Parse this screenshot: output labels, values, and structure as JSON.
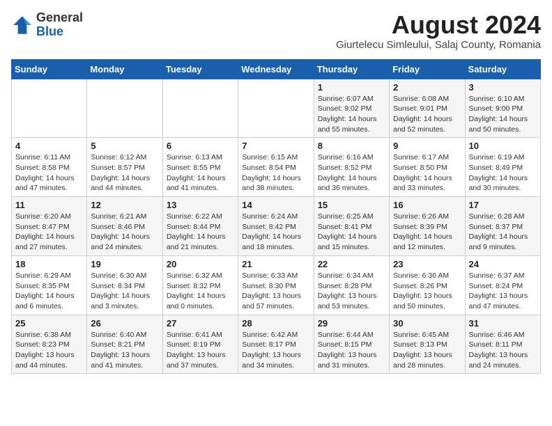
{
  "logo": {
    "general": "General",
    "blue": "Blue"
  },
  "title": "August 2024",
  "subtitle": "Giurtelecu Simleului, Salaj County, Romania",
  "weekdays": [
    "Sunday",
    "Monday",
    "Tuesday",
    "Wednesday",
    "Thursday",
    "Friday",
    "Saturday"
  ],
  "weeks": [
    [
      {
        "day": "",
        "info": ""
      },
      {
        "day": "",
        "info": ""
      },
      {
        "day": "",
        "info": ""
      },
      {
        "day": "",
        "info": ""
      },
      {
        "day": "1",
        "info": "Sunrise: 6:07 AM\nSunset: 9:02 PM\nDaylight: 14 hours\nand 55 minutes."
      },
      {
        "day": "2",
        "info": "Sunrise: 6:08 AM\nSunset: 9:01 PM\nDaylight: 14 hours\nand 52 minutes."
      },
      {
        "day": "3",
        "info": "Sunrise: 6:10 AM\nSunset: 9:00 PM\nDaylight: 14 hours\nand 50 minutes."
      }
    ],
    [
      {
        "day": "4",
        "info": "Sunrise: 6:11 AM\nSunset: 8:58 PM\nDaylight: 14 hours\nand 47 minutes."
      },
      {
        "day": "5",
        "info": "Sunrise: 6:12 AM\nSunset: 8:57 PM\nDaylight: 14 hours\nand 44 minutes."
      },
      {
        "day": "6",
        "info": "Sunrise: 6:13 AM\nSunset: 8:55 PM\nDaylight: 14 hours\nand 41 minutes."
      },
      {
        "day": "7",
        "info": "Sunrise: 6:15 AM\nSunset: 8:54 PM\nDaylight: 14 hours\nand 38 minutes."
      },
      {
        "day": "8",
        "info": "Sunrise: 6:16 AM\nSunset: 8:52 PM\nDaylight: 14 hours\nand 36 minutes."
      },
      {
        "day": "9",
        "info": "Sunrise: 6:17 AM\nSunset: 8:50 PM\nDaylight: 14 hours\nand 33 minutes."
      },
      {
        "day": "10",
        "info": "Sunrise: 6:19 AM\nSunset: 8:49 PM\nDaylight: 14 hours\nand 30 minutes."
      }
    ],
    [
      {
        "day": "11",
        "info": "Sunrise: 6:20 AM\nSunset: 8:47 PM\nDaylight: 14 hours\nand 27 minutes."
      },
      {
        "day": "12",
        "info": "Sunrise: 6:21 AM\nSunset: 8:46 PM\nDaylight: 14 hours\nand 24 minutes."
      },
      {
        "day": "13",
        "info": "Sunrise: 6:22 AM\nSunset: 8:44 PM\nDaylight: 14 hours\nand 21 minutes."
      },
      {
        "day": "14",
        "info": "Sunrise: 6:24 AM\nSunset: 8:42 PM\nDaylight: 14 hours\nand 18 minutes."
      },
      {
        "day": "15",
        "info": "Sunrise: 6:25 AM\nSunset: 8:41 PM\nDaylight: 14 hours\nand 15 minutes."
      },
      {
        "day": "16",
        "info": "Sunrise: 6:26 AM\nSunset: 8:39 PM\nDaylight: 14 hours\nand 12 minutes."
      },
      {
        "day": "17",
        "info": "Sunrise: 6:28 AM\nSunset: 8:37 PM\nDaylight: 14 hours\nand 9 minutes."
      }
    ],
    [
      {
        "day": "18",
        "info": "Sunrise: 6:29 AM\nSunset: 8:35 PM\nDaylight: 14 hours\nand 6 minutes."
      },
      {
        "day": "19",
        "info": "Sunrise: 6:30 AM\nSunset: 8:34 PM\nDaylight: 14 hours\nand 3 minutes."
      },
      {
        "day": "20",
        "info": "Sunrise: 6:32 AM\nSunset: 8:32 PM\nDaylight: 14 hours\nand 0 minutes."
      },
      {
        "day": "21",
        "info": "Sunrise: 6:33 AM\nSunset: 8:30 PM\nDaylight: 13 hours\nand 57 minutes."
      },
      {
        "day": "22",
        "info": "Sunrise: 6:34 AM\nSunset: 8:28 PM\nDaylight: 13 hours\nand 53 minutes."
      },
      {
        "day": "23",
        "info": "Sunrise: 6:36 AM\nSunset: 8:26 PM\nDaylight: 13 hours\nand 50 minutes."
      },
      {
        "day": "24",
        "info": "Sunrise: 6:37 AM\nSunset: 8:24 PM\nDaylight: 13 hours\nand 47 minutes."
      }
    ],
    [
      {
        "day": "25",
        "info": "Sunrise: 6:38 AM\nSunset: 8:23 PM\nDaylight: 13 hours\nand 44 minutes."
      },
      {
        "day": "26",
        "info": "Sunrise: 6:40 AM\nSunset: 8:21 PM\nDaylight: 13 hours\nand 41 minutes."
      },
      {
        "day": "27",
        "info": "Sunrise: 6:41 AM\nSunset: 8:19 PM\nDaylight: 13 hours\nand 37 minutes."
      },
      {
        "day": "28",
        "info": "Sunrise: 6:42 AM\nSunset: 8:17 PM\nDaylight: 13 hours\nand 34 minutes."
      },
      {
        "day": "29",
        "info": "Sunrise: 6:44 AM\nSunset: 8:15 PM\nDaylight: 13 hours\nand 31 minutes."
      },
      {
        "day": "30",
        "info": "Sunrise: 6:45 AM\nSunset: 8:13 PM\nDaylight: 13 hours\nand 28 minutes."
      },
      {
        "day": "31",
        "info": "Sunrise: 6:46 AM\nSunset: 8:11 PM\nDaylight: 13 hours\nand 24 minutes."
      }
    ]
  ]
}
